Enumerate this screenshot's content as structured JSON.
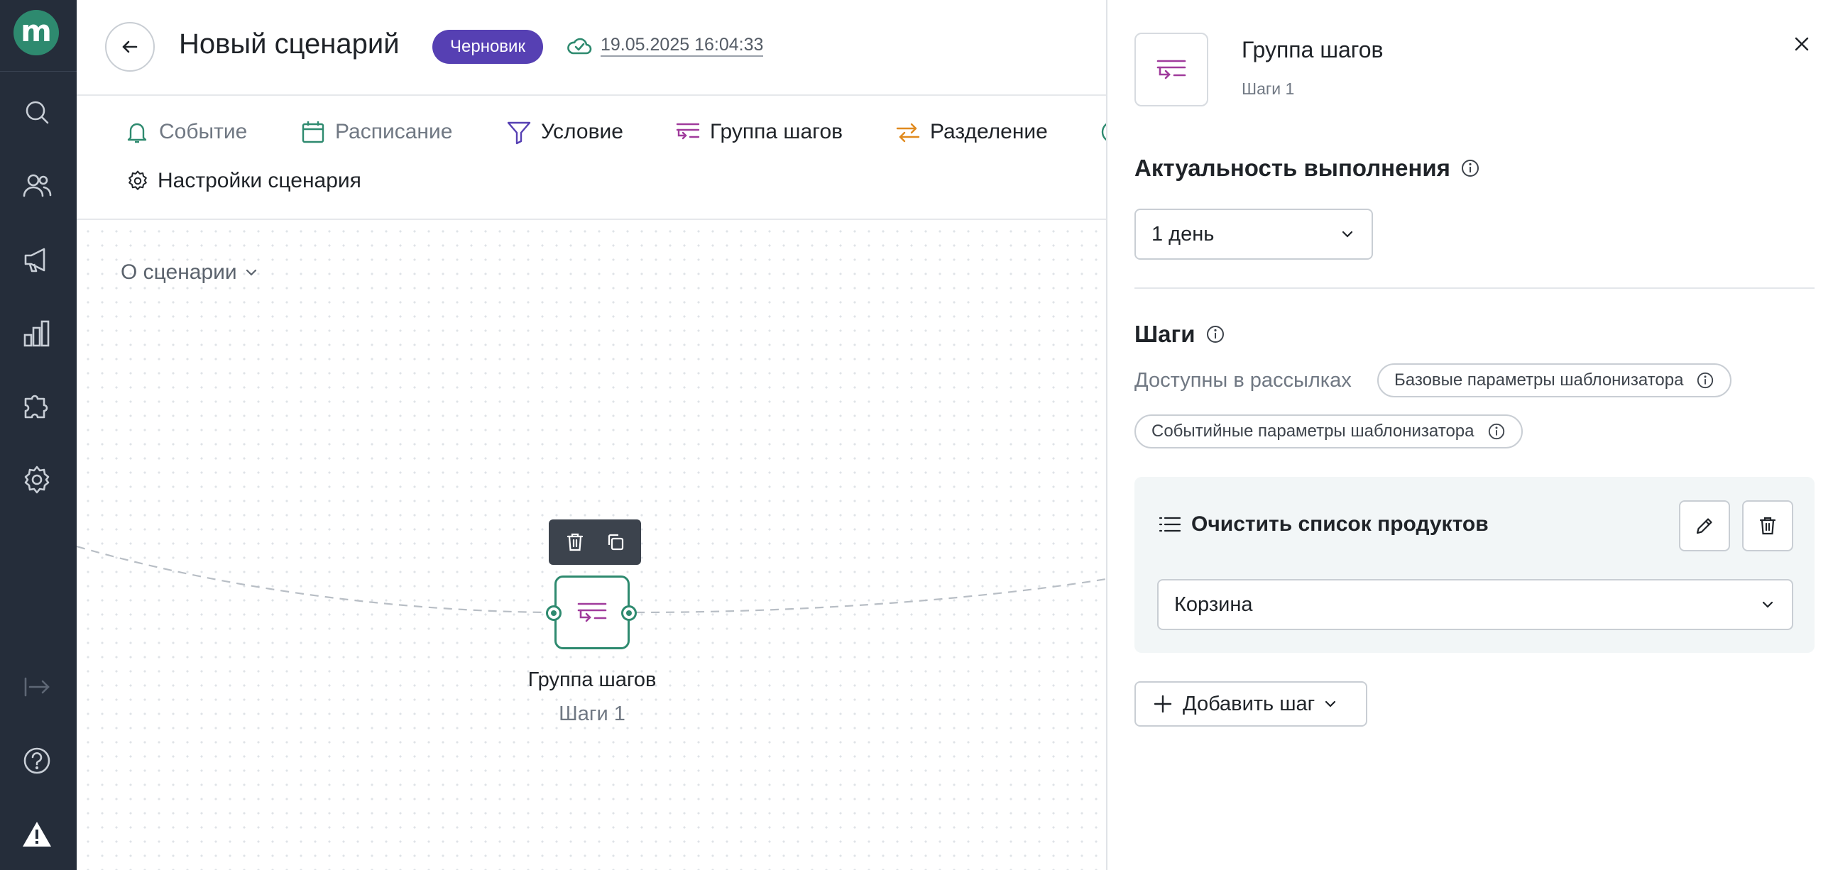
{
  "rail": {
    "logo": "m",
    "items": [
      {
        "icon": "search-icon"
      },
      {
        "icon": "users-icon"
      },
      {
        "icon": "megaphone-icon"
      },
      {
        "icon": "analytics-icon"
      },
      {
        "icon": "puzzle-icon"
      },
      {
        "icon": "gear-icon"
      },
      {
        "icon": "collapse-icon"
      },
      {
        "icon": "help-icon"
      },
      {
        "icon": "warning-icon"
      }
    ]
  },
  "header": {
    "title": "Новый сценарий",
    "status_badge": "Черновик",
    "saved_at": "19.05.2025 16:04:33"
  },
  "toolbar": {
    "items": [
      {
        "label": "Событие",
        "icon": "bell-icon",
        "color": "#2e8a6f"
      },
      {
        "label": "Расписание",
        "icon": "calendar-icon",
        "color": "#2e8a6f"
      },
      {
        "label": "Условие",
        "icon": "filter-icon",
        "color": "#5640b3"
      },
      {
        "label": "Группа шагов",
        "icon": "step-group-icon",
        "color": "#a03b9c"
      },
      {
        "label": "Разделение",
        "icon": "split-icon",
        "color": "#e08a1e"
      }
    ],
    "settings_label": "Настройки сценария"
  },
  "canvas": {
    "about_label": "О сценарии",
    "node": {
      "title": "Группа шагов",
      "subtitle": "Шаги 1"
    }
  },
  "panel": {
    "title": "Группа шагов",
    "subtitle": "Шаги 1",
    "relevance": {
      "heading": "Актуальность выполнения",
      "selected": "1 день"
    },
    "steps": {
      "heading": "Шаги",
      "available_label": "Доступны в рассылках",
      "chips": [
        "Базовые параметры шаблонизатора",
        "Событийные параметры шаблонизатора"
      ],
      "items": [
        {
          "title": "Очистить список продуктов",
          "selected": "Корзина"
        }
      ],
      "add_label": "Добавить шаг"
    }
  },
  "colors": {
    "accent_green": "#2e8a6f",
    "badge_purple": "#5640b3",
    "step_group_magenta": "#a03b9c",
    "rail_bg": "#252d3a"
  }
}
